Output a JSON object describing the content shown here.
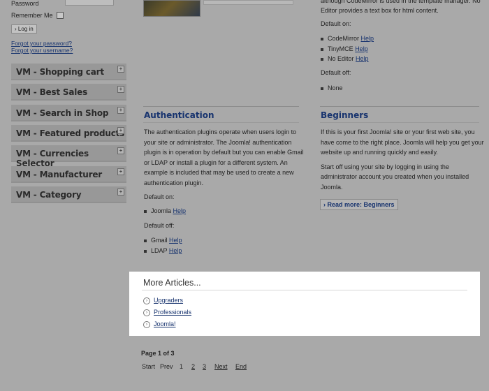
{
  "login": {
    "password_label": "Password",
    "remember_label": "Remember Me",
    "login_button": "Log in",
    "forgot_password": "Forgot your password?",
    "forgot_username": "Forgot your username?"
  },
  "modules": [
    {
      "title": "VM - Shopping cart"
    },
    {
      "title": "VM - Best Sales"
    },
    {
      "title": "VM - Search in Shop"
    },
    {
      "title": "VM - Featured products"
    },
    {
      "title": "VM - Currencies Selector"
    },
    {
      "title": "VM - Manufacturer"
    },
    {
      "title": "VM - Category"
    }
  ],
  "module_toggle": "+",
  "editors": {
    "top_text_1": "although CodeMirror is used in the template manager. No",
    "top_text_2": "Editor provides a text box for html content.",
    "default_on": "Default on:",
    "items_on": [
      {
        "name": "CodeMirror",
        "link": "Help"
      },
      {
        "name": "TinyMCE",
        "link": "Help"
      },
      {
        "name": "No Editor",
        "link": "Help"
      }
    ],
    "default_off": "Default off:",
    "items_off": [
      {
        "name": "None"
      }
    ]
  },
  "authentication": {
    "heading": "Authentication",
    "body": [
      "The authentication plugins operate when users login to",
      "your site or administrator. The Joomla! authentication",
      "plugin is in operation by default but you can enable Gmail",
      "or LDAP or install a plugin for a different system. An",
      "example is included that may be used to create a new",
      "authentication plugin."
    ],
    "default_on": "Default on:",
    "items_on": [
      {
        "name": "Joomla",
        "link": "Help"
      }
    ],
    "default_off": "Default off:",
    "items_off": [
      {
        "name": "Gmail",
        "link": "Help"
      },
      {
        "name": "LDAP",
        "link": "Help"
      }
    ]
  },
  "beginners": {
    "heading": "Beginners",
    "para1": [
      "If this is your first Joomla! site or your first web site, you",
      "have come to the right place. Joomla will help you get your",
      "website up and running quickly and easily."
    ],
    "para2": [
      "Start off using your site by logging in using the",
      "administrator account you created when you installed",
      "Joomla."
    ],
    "read_more": "Read more: Beginners"
  },
  "more_articles": {
    "heading": "More Articles...",
    "items": [
      "Upgraders",
      "Professionals",
      "Joomla!"
    ]
  },
  "pagination": {
    "count": "Page 1 of 3",
    "start": "Start",
    "prev": "Prev",
    "current": "1",
    "pages": [
      "2",
      "3"
    ],
    "next": "Next",
    "end": "End"
  }
}
